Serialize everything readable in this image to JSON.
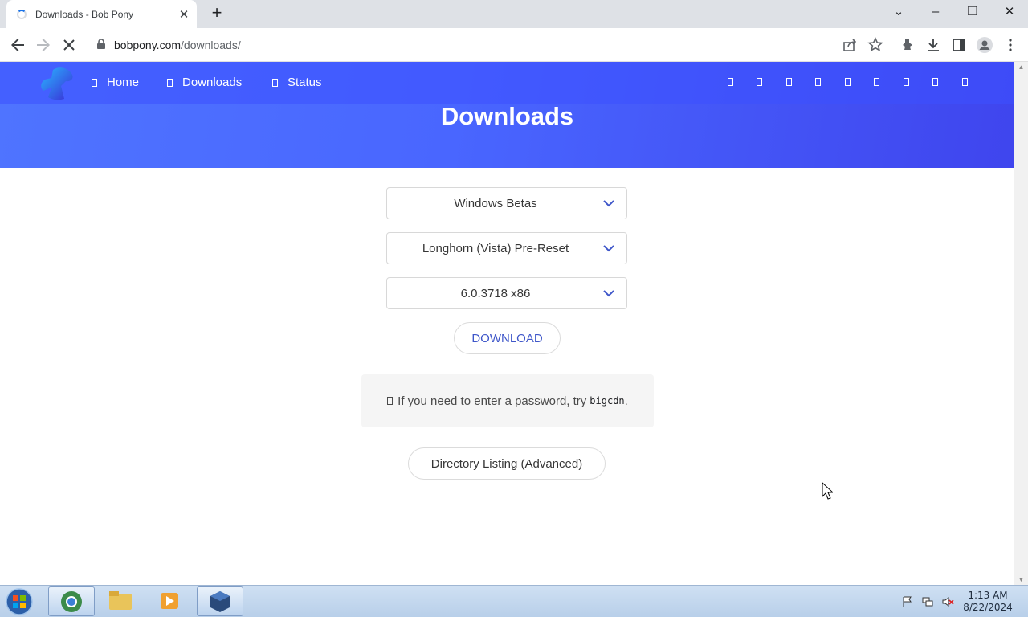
{
  "browser": {
    "tab_title": "Downloads - Bob Pony",
    "tab_close": "✕",
    "new_tab": "+",
    "url_host": "bobpony.com",
    "url_path": "/downloads/",
    "window_controls": {
      "dropdown": "⌄",
      "minimize": "–",
      "restore": "❐",
      "close": "✕"
    }
  },
  "site": {
    "nav": [
      {
        "label": "Home"
      },
      {
        "label": "Downloads"
      },
      {
        "label": "Status"
      }
    ],
    "hero_title": "Downloads",
    "accent_color": "#4a5cf7"
  },
  "download_form": {
    "category": "Windows Betas",
    "product": "Longhorn (Vista) Pre-Reset",
    "build": "6.0.3718 x86",
    "download_label": "DOWNLOAD",
    "notice_text": "If you need to enter a password, try",
    "notice_code": "bigcdn",
    "notice_end": ".",
    "directory_label": "Directory Listing (Advanced)"
  },
  "taskbar": {
    "time": "1:13 AM",
    "date": "8/22/2024"
  }
}
